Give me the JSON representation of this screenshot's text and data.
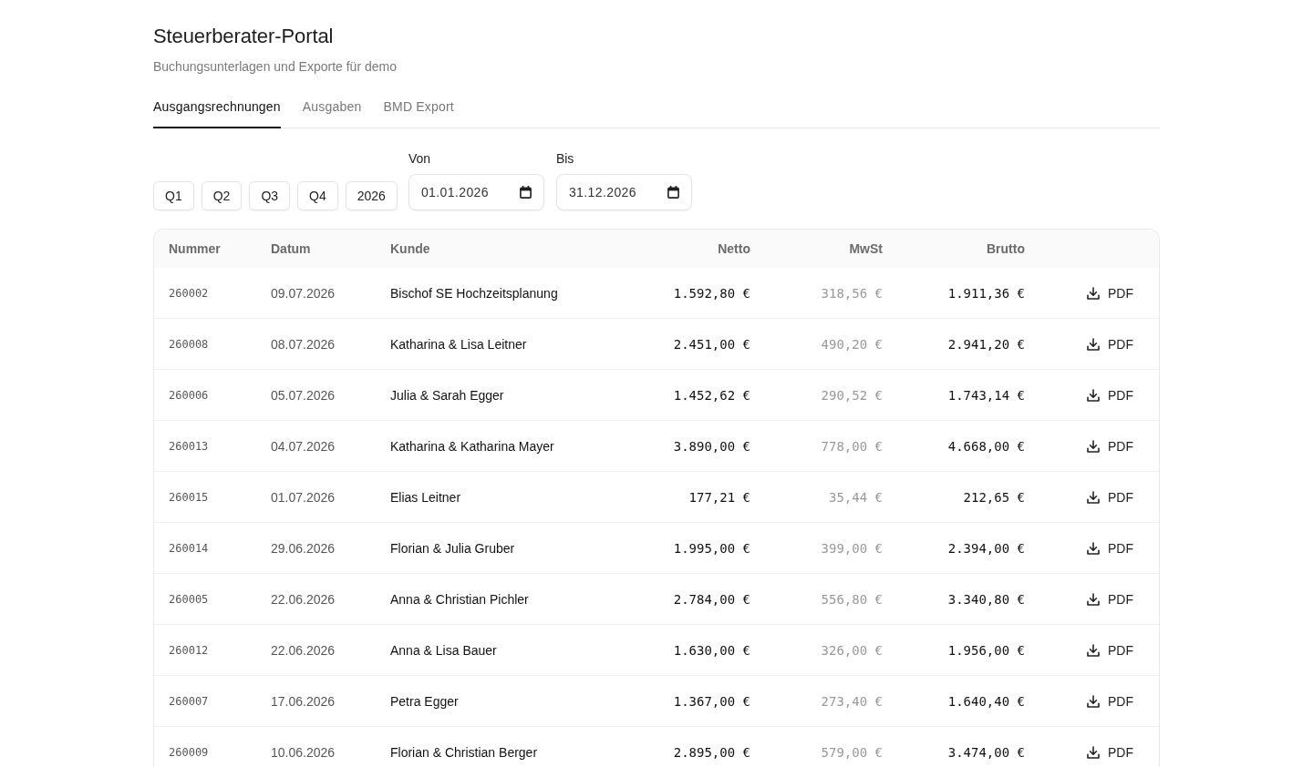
{
  "page": {
    "title": "Steuerberater-Portal",
    "subtitle": "Buchungsunterlagen und Exporte für demo"
  },
  "tabs": [
    {
      "label": "Ausgangsrechnungen",
      "selected": true
    },
    {
      "label": "Ausgaben",
      "selected": false
    },
    {
      "label": "BMD Export",
      "selected": false
    }
  ],
  "filters": {
    "period_buttons": [
      "Q1",
      "Q2",
      "Q3",
      "Q4",
      "2026"
    ],
    "date_from": {
      "label": "Von",
      "value": "01.01.2026"
    },
    "date_to": {
      "label": "Bis",
      "value": "31.12.2026"
    }
  },
  "table": {
    "columns": [
      "Nummer",
      "Datum",
      "Kunde",
      "Netto",
      "MwSt",
      "Brutto"
    ],
    "rows": [
      {
        "number": "260002",
        "date": "09.07.2026",
        "customer": "Bischof SE Hochzeitsplanung",
        "net": "1.592,80 €",
        "vat": "318,56 €",
        "gross": "1.911,36 €",
        "action": "PDF"
      },
      {
        "number": "260008",
        "date": "08.07.2026",
        "customer": "Katharina & Lisa Leitner",
        "net": "2.451,00 €",
        "vat": "490,20 €",
        "gross": "2.941,20 €",
        "action": "PDF"
      },
      {
        "number": "260006",
        "date": "05.07.2026",
        "customer": "Julia & Sarah Egger",
        "net": "1.452,62 €",
        "vat": "290,52 €",
        "gross": "1.743,14 €",
        "action": "PDF"
      },
      {
        "number": "260013",
        "date": "04.07.2026",
        "customer": "Katharina & Katharina Mayer",
        "net": "3.890,00 €",
        "vat": "778,00 €",
        "gross": "4.668,00 €",
        "action": "PDF"
      },
      {
        "number": "260015",
        "date": "01.07.2026",
        "customer": "Elias Leitner",
        "net": "177,21 €",
        "vat": "35,44 €",
        "gross": "212,65 €",
        "action": "PDF"
      },
      {
        "number": "260014",
        "date": "29.06.2026",
        "customer": "Florian & Julia Gruber",
        "net": "1.995,00 €",
        "vat": "399,00 €",
        "gross": "2.394,00 €",
        "action": "PDF"
      },
      {
        "number": "260005",
        "date": "22.06.2026",
        "customer": "Anna & Christian Pichler",
        "net": "2.784,00 €",
        "vat": "556,80 €",
        "gross": "3.340,80 €",
        "action": "PDF"
      },
      {
        "number": "260012",
        "date": "22.06.2026",
        "customer": "Anna & Lisa Bauer",
        "net": "1.630,00 €",
        "vat": "326,00 €",
        "gross": "1.956,00 €",
        "action": "PDF"
      },
      {
        "number": "260007",
        "date": "17.06.2026",
        "customer": "Petra Egger",
        "net": "1.367,00 €",
        "vat": "273,40 €",
        "gross": "1.640,40 €",
        "action": "PDF"
      },
      {
        "number": "260009",
        "date": "10.06.2026",
        "customer": "Florian & Christian Berger",
        "net": "2.895,00 €",
        "vat": "579,00 €",
        "gross": "3.474,00 €",
        "action": "PDF"
      }
    ]
  }
}
